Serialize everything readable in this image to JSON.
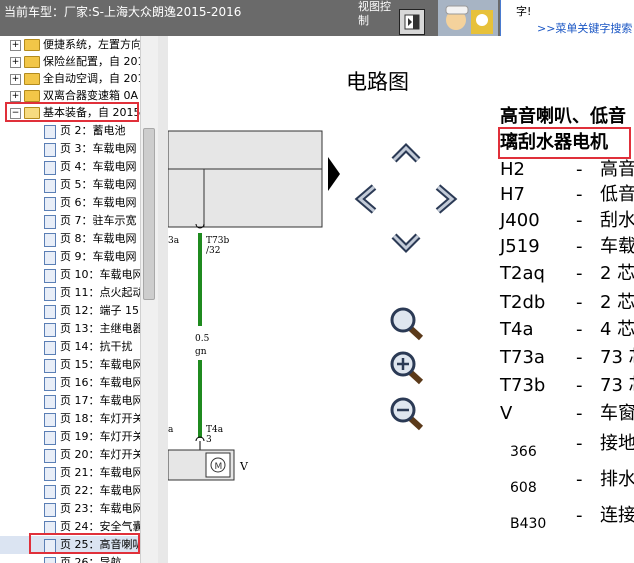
{
  "header": {
    "title": "当前车型：厂家:S-上海大众朗逸2015-2016",
    "view_control": "视图控制",
    "promo_text": "字!",
    "promo_link": ">>菜单关键字搜索"
  },
  "toc": {
    "folders": [
      "便捷系统，左置方向",
      "保险丝配置，自 201",
      "全自动空调，自 201",
      "双离合器变速箱 0A",
      "基本装备，自 2015"
    ],
    "pages": [
      "页 2：蓄电池",
      "页 3：车载电网",
      "页 4：车载电网",
      "页 5：车载电网",
      "页 6：车载电网",
      "页 7：驻车示宽",
      "页 8：车载电网",
      "页 9：车载电网",
      "页 10：车载电网",
      "页 11：点火起动",
      "页 12：端子 15",
      "页 13：主继电器",
      "页 14：抗干扰",
      "页 15：车载电网",
      "页 16：车载电网",
      "页 17：车载电网",
      "页 18：车灯开关",
      "页 19：车灯开关",
      "页 20：车灯开关",
      "页 21：车载电网",
      "页 22：车载电网",
      "页 23：车载电网",
      "页 24：安全气囊",
      "页 25：高音喇叭",
      "页 26：导航"
    ]
  },
  "diagram": {
    "left_label": "3a",
    "top_connector": "T73b",
    "top_connector_pin": "/32",
    "wire_size": "0.5",
    "wire_color": "gn",
    "left_label_bottom": "a",
    "bottom_connector": "T4a",
    "bottom_connector_pin": "3",
    "component_id": "V",
    "wire_hex": "#1f8a1f"
  },
  "main": {
    "heading": "电路图",
    "legend_title_1": "高音喇叭、低音",
    "legend_title_2": "璃刮水器电机",
    "legend": [
      {
        "code": "H2",
        "dash": "-",
        "desc": "高音"
      },
      {
        "code": "H7",
        "dash": "-",
        "desc": "低音"
      },
      {
        "code": "J400",
        "dash": "-",
        "desc": "刮水"
      },
      {
        "code": "J519",
        "dash": "-",
        "desc": "车载"
      },
      {
        "code": "T2aq",
        "dash": "-",
        "desc": "2 芯"
      },
      {
        "code": "T2db",
        "dash": "-",
        "desc": "2 芯"
      },
      {
        "code": "T4a",
        "dash": "-",
        "desc": "4 芯"
      },
      {
        "code": "T73a",
        "dash": "-",
        "desc": "73 芯"
      },
      {
        "code": "T73b",
        "dash": "-",
        "desc": "73 芯"
      },
      {
        "code": "V",
        "dash": "-",
        "desc": "车窗"
      },
      {
        "code": "366",
        "dash": "-",
        "desc": "接地"
      },
      {
        "code": "608",
        "dash": "-",
        "desc": "排水"
      },
      {
        "code": "B430",
        "dash": "-",
        "desc": "连接"
      }
    ]
  },
  "icons": {
    "nav_up": "chevron-up-icon",
    "nav_down": "chevron-down-icon",
    "nav_left": "chevron-left-icon",
    "nav_right": "chevron-right-icon",
    "zoom": "magnifier-icon",
    "zoom_in": "zoom-in-icon",
    "zoom_out": "zoom-out-icon"
  },
  "colors": {
    "highlight": "#e0303a",
    "header_bg": "#6a6a6a",
    "link": "#1a56c4"
  }
}
